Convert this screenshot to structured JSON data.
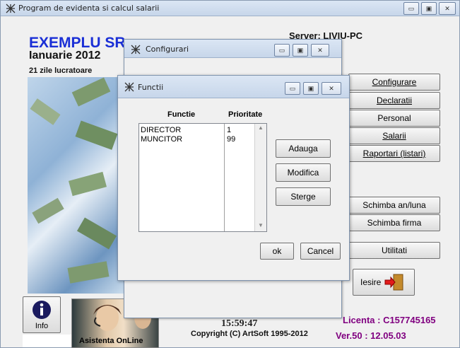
{
  "main_window": {
    "title": "Program de evidenta si calcul salarii",
    "company": "EXEMPLU SR",
    "period": "Ianuarie 2012",
    "workdays": "21 zile lucratoare",
    "server": "Server: LIVIU-PC",
    "time": "15:59:47",
    "copyright": "Copyright (C) ArtSoft 1995-2012",
    "license": "Licenta : C157745165",
    "version": "Ver.50  :  12.05.03",
    "info_label": "Info",
    "assist_label": "Asistenta OnLine",
    "exit_label": "Iesire"
  },
  "menu": {
    "configurare": "Configurare",
    "declaratii": "Declaratii",
    "personal": "Personal",
    "salarii": "Salarii",
    "raportari": "Raportari (listari)",
    "schimba_an": "Schimba an/luna",
    "schimba_firma": "Schimba firma",
    "utilitati": "Utilitati"
  },
  "config_window": {
    "title": "Configurari"
  },
  "functii_window": {
    "title": "Functii",
    "col_functie": "Functie",
    "col_prioritate": "Prioritate",
    "rows": [
      {
        "functie": "DIRECTOR",
        "prioritate": "1"
      },
      {
        "functie": "MUNCITOR",
        "prioritate": "99"
      }
    ],
    "adauga": "Adauga",
    "modifica": "Modifica",
    "sterge": "Sterge",
    "ok": "ok",
    "cancel": "Cancel"
  },
  "colors": {
    "company": "#1a2fd6",
    "license": "#800080",
    "window_bg": "#f0f0f0"
  }
}
